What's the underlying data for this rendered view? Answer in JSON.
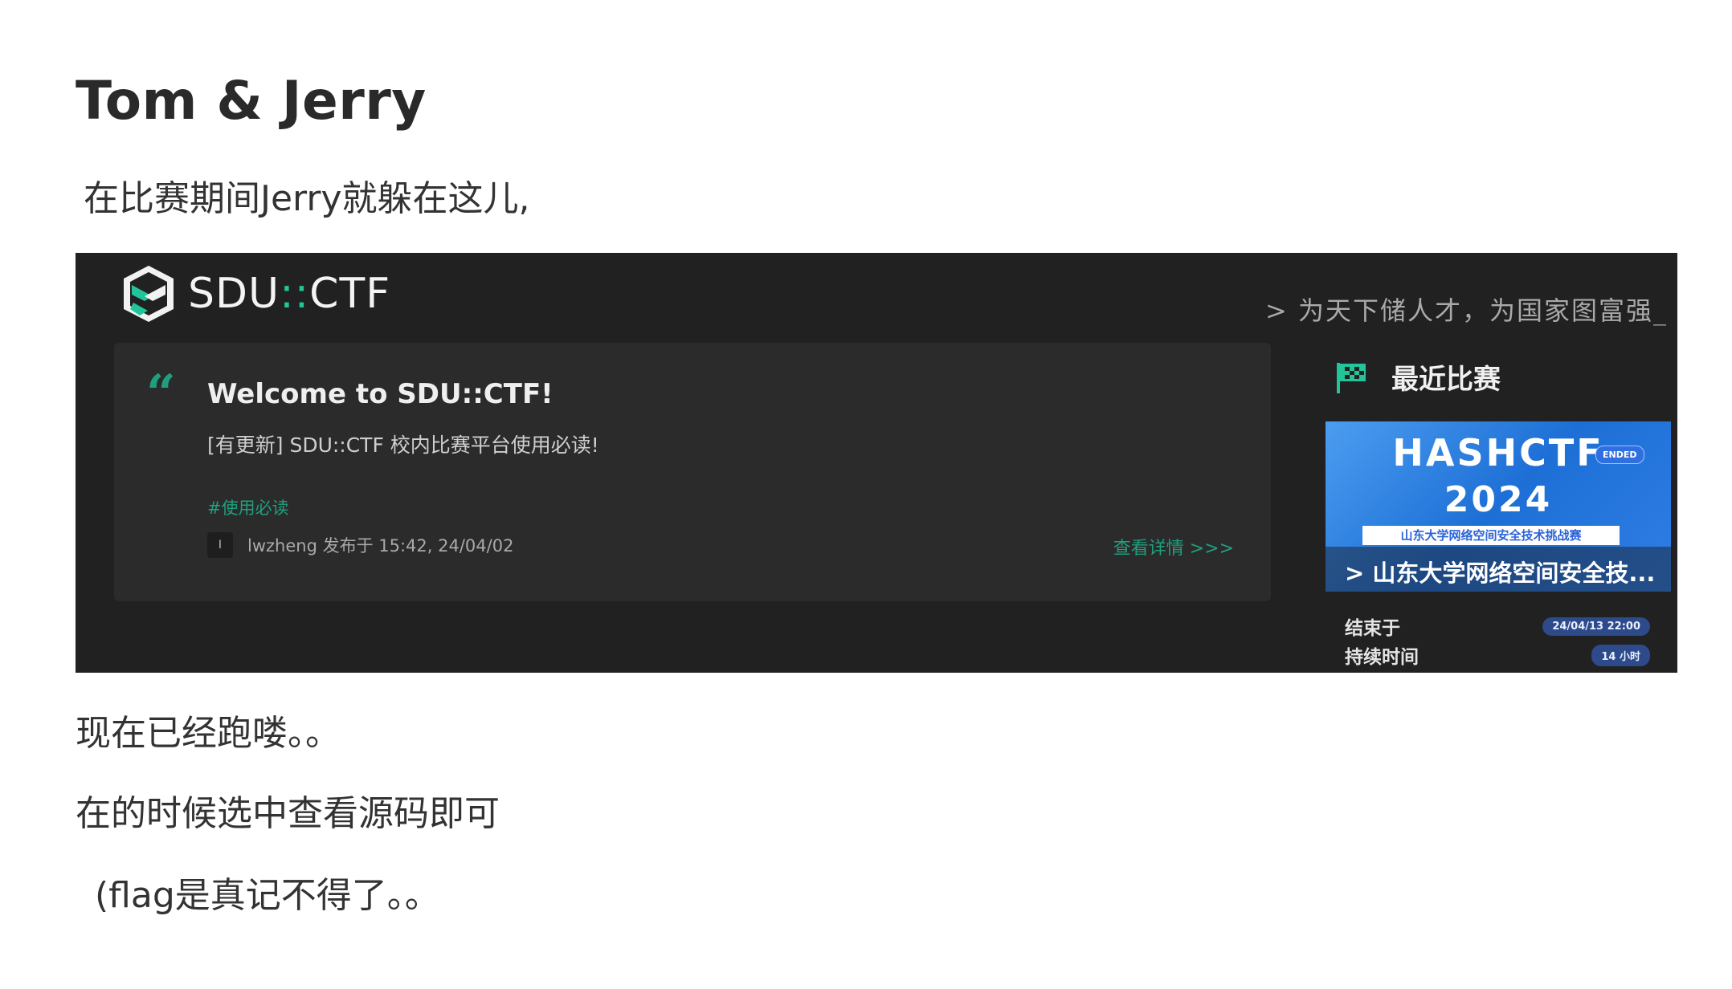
{
  "article": {
    "title": "Tom & Jerry",
    "intro": "在比赛期间Jerry就躲在这儿,",
    "para_after_1": "现在已经跑喽。。",
    "para_after_2": "在的时候选中查看源码即可",
    "para_after_3": "(flag是真记不得了。。"
  },
  "screenshot": {
    "brand": {
      "name_left": "SDU",
      "separator": "::",
      "name_right": "CTF",
      "logo_icon": "sdu-ctf-logo"
    },
    "slogan": "> 为天下储人才，为国家图富强_",
    "notice": {
      "quote_icon": "quote-icon",
      "title": "Welcome to SDU::CTF!",
      "subtitle": "[有更新] SDU::CTF 校内比赛平台使用必读!",
      "tag": "#使用必读",
      "avatar_text": "I",
      "meta": "lwzheng 发布于 15:42, 24/04/02",
      "details_link": "查看详情 >>>"
    },
    "recent": {
      "flag_icon": "checkered-flag-icon",
      "title": "最近比赛",
      "event": {
        "name": "HASHCTF",
        "badge": "ENDED",
        "year": "2024",
        "banner": "山东大学网络空间安全技术挑战赛",
        "caption": "> 山东大学网络空间安全技..."
      },
      "end_label": "结束于",
      "end_value": "24/04/13 22:00",
      "duration_label": "持续时间",
      "duration_value": "14 小时"
    }
  },
  "colors": {
    "accent": "#1f9f7e",
    "dark_bg": "#212121",
    "card_bg": "#2b2b2b",
    "event_blue": "#1d6fd6"
  }
}
